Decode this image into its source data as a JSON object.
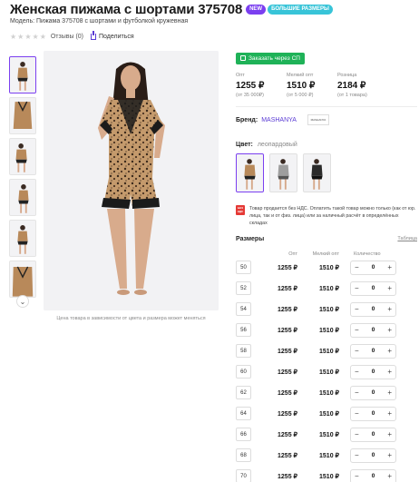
{
  "product": {
    "title": "Женская пижама с шортами 375708",
    "badges": {
      "new": "NEW",
      "big": "БОЛЬШИЕ РАЗМЕРЫ"
    },
    "model_line": "Модель: Пижама 375708 с шортами и футболкой кружевная",
    "reviews_label": "Отзывы (0)",
    "share_label": "Поделиться",
    "stars": [
      "★",
      "★",
      "★",
      "★",
      "★"
    ],
    "photo_note": "Цена товара в зависимости от цвета и размера может меняться"
  },
  "order": {
    "button_label": "Заказать через СП"
  },
  "prices": [
    {
      "label": "Опт",
      "value": "1255 ₽",
      "sub": "(от 35 000₽)"
    },
    {
      "label": "Мелкий опт",
      "value": "1510 ₽",
      "sub": "(от 5 000 ₽)"
    },
    {
      "label": "Розница",
      "value": "2184 ₽",
      "sub": "(от 1 товара)"
    }
  ],
  "brand": {
    "label": "Бренд:",
    "value": "MASHANYA",
    "logo_text": "MASHANYA"
  },
  "color": {
    "label": "Цвет:",
    "value": "леопардовый"
  },
  "vat": {
    "badge": "БЕЗ НДС",
    "text": "Товар продается без НДС. Оплатить такой товар можно только (как от юр. лица, так и от физ. лица) или за наличный расчёт в определённых складах"
  },
  "sizes": {
    "label": "Размеры",
    "table_link": "Таблица",
    "columns": {
      "opt": "Опт",
      "small_opt": "Мелкий опт",
      "qty": "Количество"
    },
    "rows": [
      {
        "size": "50",
        "opt": "1255 ₽",
        "small": "1510 ₽",
        "qty": "0"
      },
      {
        "size": "52",
        "opt": "1255 ₽",
        "small": "1510 ₽",
        "qty": "0"
      },
      {
        "size": "54",
        "opt": "1255 ₽",
        "small": "1510 ₽",
        "qty": "0"
      },
      {
        "size": "56",
        "opt": "1255 ₽",
        "small": "1510 ₽",
        "qty": "0"
      },
      {
        "size": "58",
        "opt": "1255 ₽",
        "small": "1510 ₽",
        "qty": "0"
      },
      {
        "size": "60",
        "opt": "1255 ₽",
        "small": "1510 ₽",
        "qty": "0"
      },
      {
        "size": "62",
        "opt": "1255 ₽",
        "small": "1510 ₽",
        "qty": "0"
      },
      {
        "size": "64",
        "opt": "1255 ₽",
        "small": "1510 ₽",
        "qty": "0"
      },
      {
        "size": "66",
        "opt": "1255 ₽",
        "small": "1510 ₽",
        "qty": "0"
      },
      {
        "size": "68",
        "opt": "1255 ₽",
        "small": "1510 ₽",
        "qty": "0"
      },
      {
        "size": "70",
        "opt": "1255 ₽",
        "small": "1510 ₽",
        "qty": "0"
      }
    ]
  },
  "colors": {
    "accent": "#7b3ff0",
    "green": "#1fb258",
    "brand_link": "#5a3bd4",
    "leopard": "#b8895a"
  }
}
